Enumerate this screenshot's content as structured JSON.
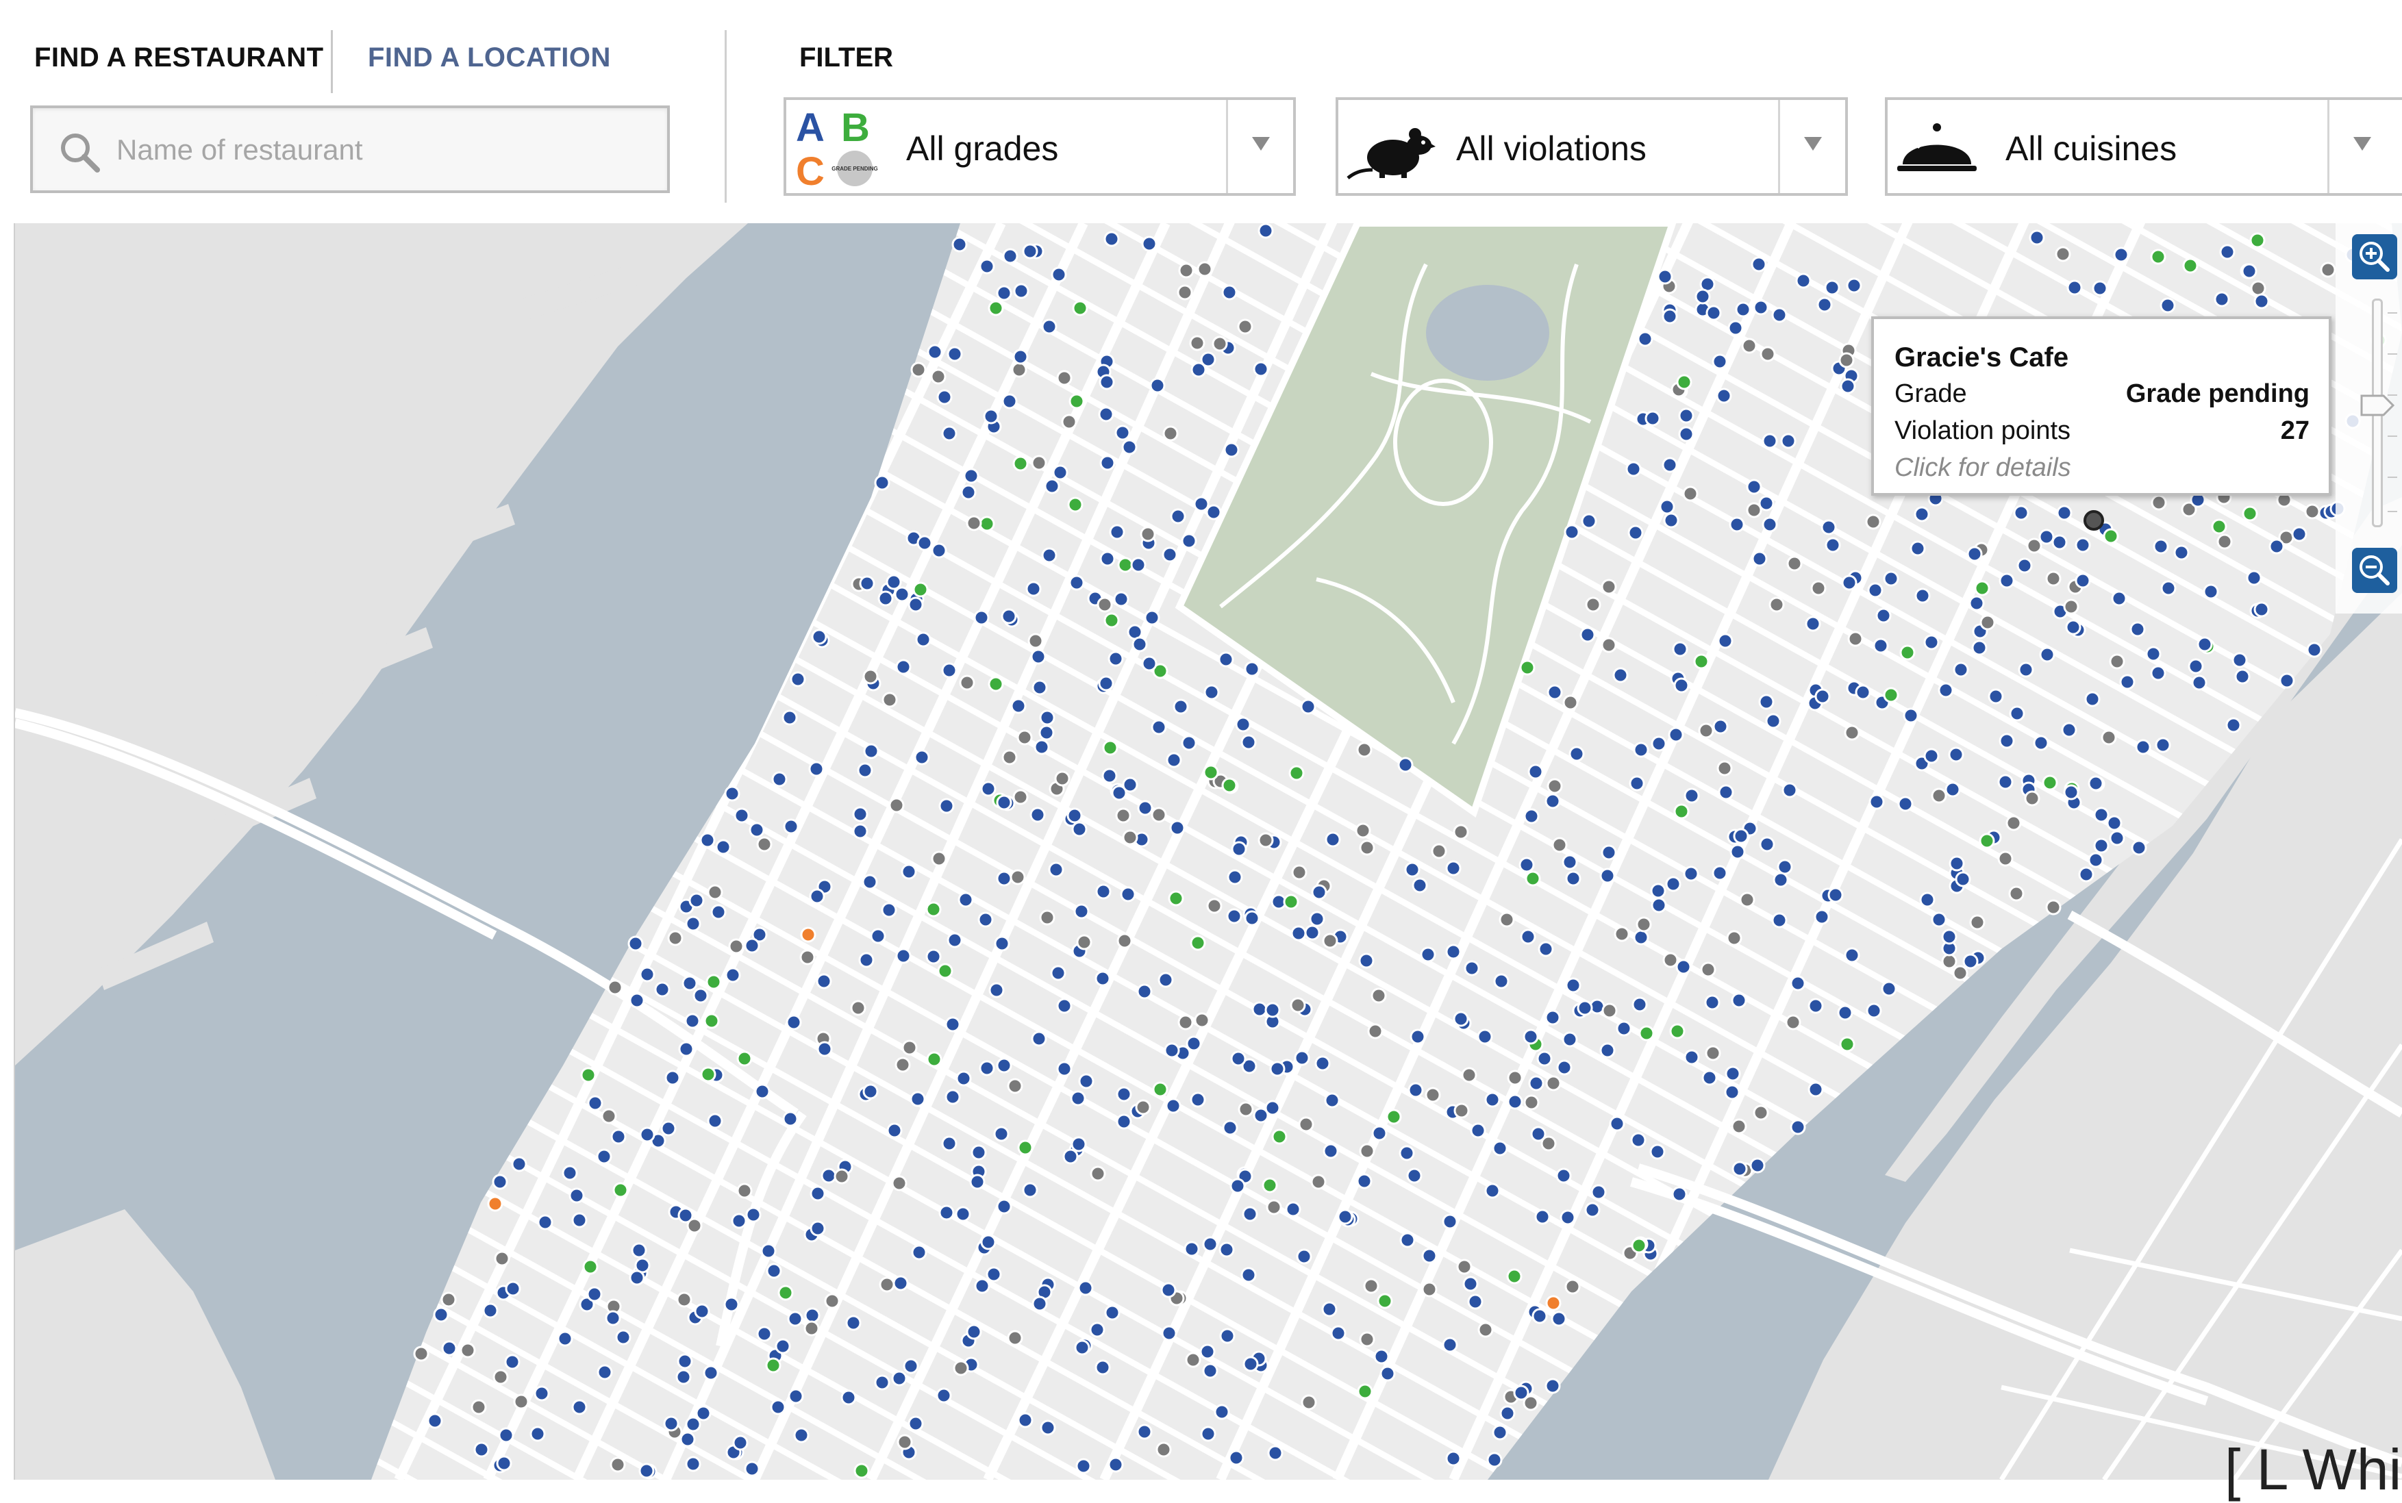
{
  "header": {
    "tabs": [
      {
        "label": "FIND A RESTAURANT",
        "active": true
      },
      {
        "label": "FIND A LOCATION",
        "active": false
      }
    ],
    "search": {
      "placeholder": "Name of restaurant",
      "value": ""
    },
    "filter_label": "FILTER",
    "filters": {
      "grades": {
        "value": "All grades",
        "icon": "grade-abc-icon",
        "icon_text": "GRADE PENDING"
      },
      "violations": {
        "value": "All violations",
        "icon": "rat-icon"
      },
      "cuisines": {
        "value": "All cuisines",
        "icon": "cloche-icon"
      }
    }
  },
  "tooltip": {
    "name": "Gracie's Cafe",
    "grade_label": "Grade",
    "grade_value": "Grade pending",
    "violation_label": "Violation points",
    "violation_value": "27",
    "footer": "Click for details"
  },
  "map": {
    "attribution": "[ L Whi"
  },
  "colors": {
    "water": "#b3bfc9",
    "land": "#e7e7e7",
    "park": "#c8d5c0",
    "road": "#ffffff",
    "marker_grade_a": "#2a52a3",
    "marker_grade_b": "#3dad3d",
    "marker_grade_c": "#f07f2d",
    "marker_pending": "#7a7a7a",
    "zoom_button": "#1e5f9e",
    "tab_inactive": "#4f6590"
  }
}
